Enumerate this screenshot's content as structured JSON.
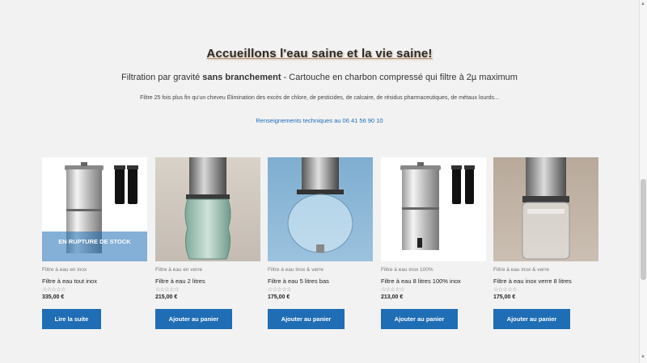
{
  "hero": {
    "title": "Accueillons l'eau saine et la vie saine!",
    "subtitle_pre": "Filtration par gravité ",
    "subtitle_bold": "sans branchement",
    "subtitle_post": " - Cartouche en charbon compressé qui filtre à 2µ maximum",
    "description": "Filtre 25 fois plus fin qu'un cheveu Élimination des excès de chlore, de pesticides, de calcaire, de résidus pharmaceutiques, de métaux lourds...",
    "contact": "Renseignements techniques au 06 41 56 90 10"
  },
  "products": [
    {
      "category": "Filtre à eau en inox",
      "name": "Filtre à eau tout inox",
      "stars": "☆☆☆☆☆",
      "price": "335,00 €",
      "button": "Lire la suite",
      "badge": "EN RUPTURE DE STOCK"
    },
    {
      "category": "Filtre à eau en verre",
      "name": "Filtre à eau 2 litres",
      "stars": "☆☆☆☆☆",
      "price": "215,00 €",
      "button": "Ajouter au panier",
      "badge": ""
    },
    {
      "category": "Filtre à eau inox & verre",
      "name": "Filtre à eau 5 litres bas",
      "stars": "☆☆☆☆☆",
      "price": "175,00 €",
      "button": "Ajouter au panier",
      "badge": ""
    },
    {
      "category": "Filtre à eau inox 100%",
      "name": "Filtre à eau 8 litres 100% inox",
      "stars": "☆☆☆☆☆",
      "price": "213,00 €",
      "button": "Ajouter au panier",
      "badge": ""
    },
    {
      "category": "Filtre à eau inox & verre",
      "name": "Filtre à eau inox verre 8 litres",
      "stars": "☆☆☆☆☆",
      "price": "175,00 €",
      "button": "Ajouter au panier",
      "badge": ""
    }
  ],
  "colors": {
    "accent": "#1f6db5",
    "background": "#f2f2f2"
  }
}
